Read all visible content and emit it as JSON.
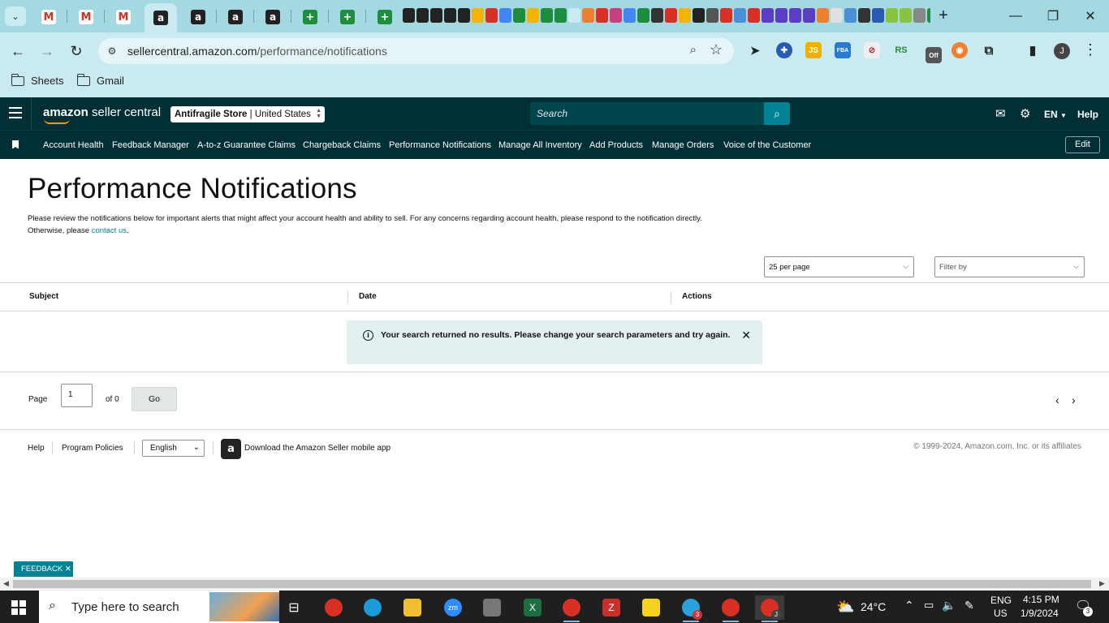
{
  "browser": {
    "tabs": [
      {
        "icon": "gmail-icon",
        "glyph": "M"
      },
      {
        "icon": "gmail-icon",
        "glyph": "M"
      },
      {
        "icon": "gmail-icon",
        "glyph": "M"
      },
      {
        "icon": "amazon-icon",
        "glyph": "a",
        "active": true
      },
      {
        "icon": "amazon-icon",
        "glyph": "a"
      },
      {
        "icon": "amazon-icon",
        "glyph": "a"
      },
      {
        "icon": "amazon-icon",
        "glyph": "a"
      },
      {
        "icon": "sheets-icon",
        "glyph": "+"
      },
      {
        "icon": "sheets-icon",
        "glyph": "+"
      },
      {
        "icon": "sheets-icon",
        "glyph": "+"
      }
    ],
    "url_host": "sellercentral.amazon.com",
    "url_path": "/performance/notifications",
    "bookmarks": [
      {
        "label": "Sheets"
      },
      {
        "label": "Gmail"
      }
    ],
    "extensions": [
      {
        "name": "js-extension-icon",
        "text": "JS",
        "color": "#f0b000"
      },
      {
        "name": "fba-extension-icon",
        "text": "FBA",
        "color": "#2a7ad0"
      },
      {
        "name": "rs-extension-icon",
        "text": "RS",
        "color": "#2a8a3a"
      },
      {
        "name": "off-extension-icon",
        "text": "Off",
        "color": "#555"
      }
    ],
    "profile_initial": "J"
  },
  "seller_central": {
    "logo_bold": "amazon",
    "logo_rest": " seller central",
    "store_name": "Antifragile Store",
    "store_country": "United States",
    "search_placeholder": "Search",
    "language": "EN",
    "help": "Help",
    "nav": [
      "Account Health",
      "Feedback Manager",
      "A-to-z Guarantee Claims",
      "Chargeback Claims",
      "Performance Notifications",
      "Manage All Inventory",
      "Add Products",
      "Manage Orders",
      "Voice of the Customer"
    ],
    "edit_label": "Edit"
  },
  "page": {
    "title": "Performance Notifications",
    "description_before": "Please review the notifications below for important alerts that might affect your account health and ability to sell. For any concerns regarding account health, please respond to the notification directly. Otherwise, please ",
    "description_link": "contact us",
    "description_after": ".",
    "per_page": "25 per page",
    "filter_placeholder": "Filter by",
    "columns": [
      "Subject",
      "Date",
      "Actions"
    ],
    "empty_message": "Your search returned no results. Please change your search parameters and try again.",
    "pagination": {
      "page_label": "Page",
      "page_value": "1",
      "of_label": "of 0",
      "go_label": "Go"
    }
  },
  "footer": {
    "help": "Help",
    "program_policies": "Program Policies",
    "language": "English",
    "app_text": "Download the Amazon Seller mobile app",
    "copyright": "© 1999-2024, Amazon.com, Inc. or its affiliates"
  },
  "feedback_tab": "FEEDBACK",
  "taskbar": {
    "search_placeholder": "Type here to search",
    "weather": "24°C",
    "lang_line1": "ENG",
    "lang_line2": "US",
    "time": "4:15 PM",
    "date": "1/9/2024",
    "notification_count": "3",
    "telegram_badge": "3",
    "chrome_badge": "J"
  },
  "colors": {
    "browser_chrome": "#a4d9e2",
    "seller_header": "#002f36",
    "accent": "#008296",
    "alert_bg": "#e3f0f2"
  }
}
